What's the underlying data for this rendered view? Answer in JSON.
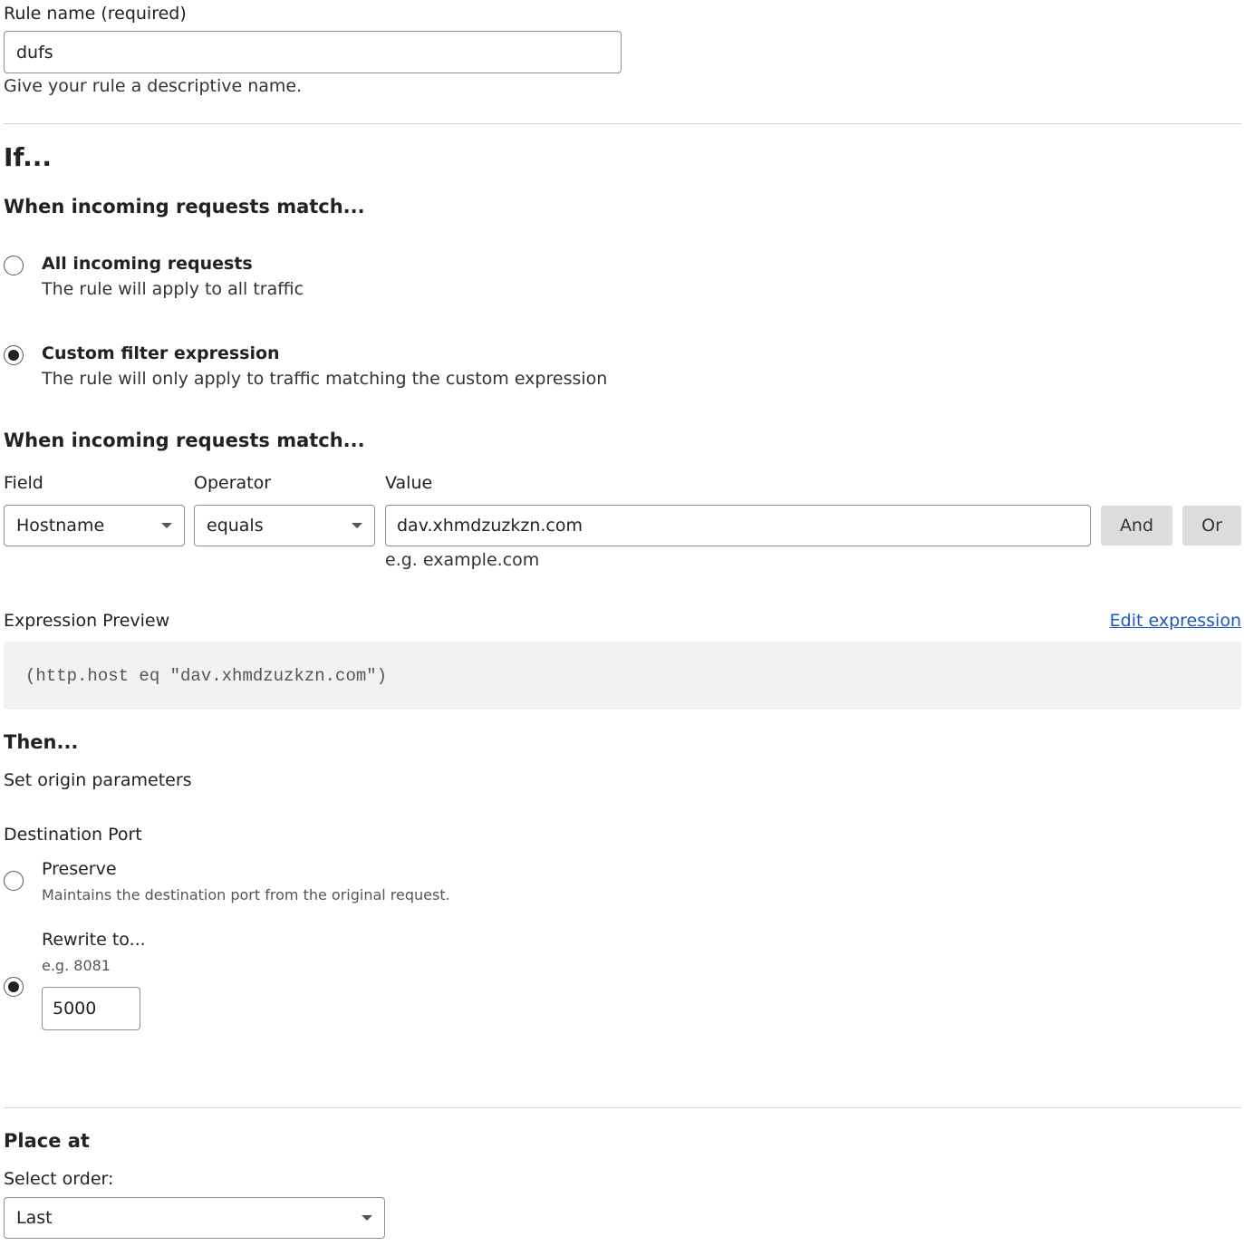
{
  "rule_name": {
    "label": "Rule name (required)",
    "value": "dufs",
    "help": "Give your rule a descriptive name."
  },
  "if_section": {
    "heading": "If...",
    "match_heading": "When incoming requests match...",
    "options": [
      {
        "title": "All incoming requests",
        "description": "The rule will apply to all traffic",
        "selected": false
      },
      {
        "title": "Custom filter expression",
        "description": "The rule will only apply to traffic matching the custom expression",
        "selected": true
      }
    ]
  },
  "filter": {
    "heading": "When incoming requests match...",
    "field_label": "Field",
    "field_value": "Hostname",
    "operator_label": "Operator",
    "operator_value": "equals",
    "value_label": "Value",
    "value_value": "dav.xhmdzuzkzn.com",
    "value_help": "e.g. example.com",
    "and_label": "And",
    "or_label": "Or"
  },
  "expression": {
    "label": "Expression Preview",
    "edit_link": "Edit expression",
    "code": "(http.host eq \"dav.xhmdzuzkzn.com\")"
  },
  "then_section": {
    "heading": "Then...",
    "subheading": "Set origin parameters",
    "port_label": "Destination Port",
    "preserve_title": "Preserve",
    "preserve_desc": "Maintains the destination port from the original request.",
    "preserve_selected": false,
    "rewrite_title": "Rewrite to...",
    "rewrite_placeholder_hint": "e.g. 8081",
    "rewrite_value": "5000",
    "rewrite_selected": true
  },
  "place_at": {
    "heading": "Place at",
    "order_label": "Select order:",
    "order_value": "Last"
  }
}
